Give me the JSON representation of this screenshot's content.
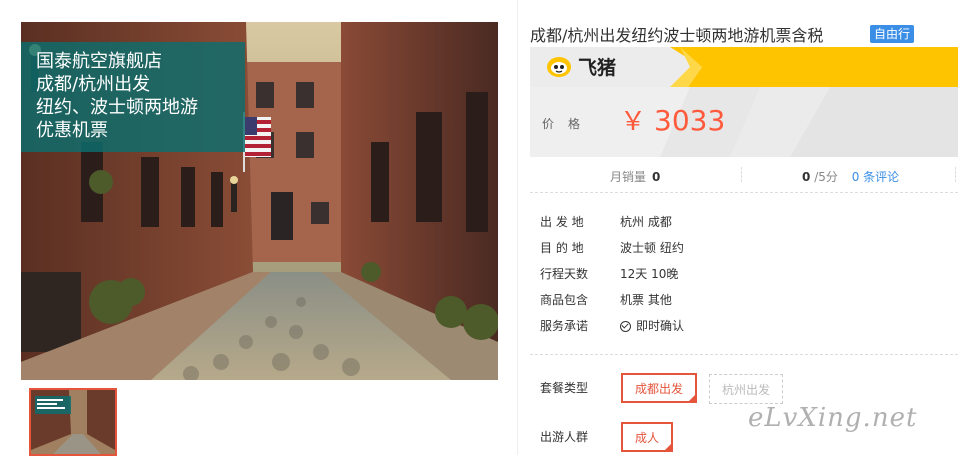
{
  "product": {
    "title": "成都/杭州出发纽约波士顿两地游机票含税",
    "badge": "自由行",
    "overlay_lines": [
      "国泰航空旗舰店",
      "成都/杭州出发",
      "纽约、波士顿两地游",
      "优惠机票"
    ]
  },
  "brand": {
    "name": "飞猪"
  },
  "price": {
    "label": "价格",
    "currency": "￥",
    "amount": "3033"
  },
  "stats": {
    "sales_label": "月销量",
    "sales_value": "0",
    "score_value": "0",
    "score_suffix": "/5分",
    "reviews_count": "0",
    "reviews_label": "条评论"
  },
  "details": [
    {
      "label": "出 发 地",
      "value": "杭州   成都"
    },
    {
      "label": "目 的 地",
      "value": "波士顿   纽约"
    },
    {
      "label": "行程天数",
      "value": "12天 10晚"
    },
    {
      "label": "商品包含",
      "value": "机票   其他"
    },
    {
      "label": "服务承诺",
      "value": "即时确认"
    }
  ],
  "options": {
    "package_label": "套餐类型",
    "packages": [
      {
        "label": "成都出发",
        "selected": true
      },
      {
        "label": "杭州出发",
        "selected": false
      }
    ],
    "traveler_label": "出游人群",
    "travelers": [
      {
        "label": "成人",
        "selected": true
      }
    ]
  },
  "watermark": "eLvXing.net",
  "colors": {
    "price": "#ff5a3c",
    "accent": "#e4553c",
    "badge": "#3a8ee6",
    "brand_yellow": "#ffc400",
    "overlay": "#0c6e6e"
  }
}
